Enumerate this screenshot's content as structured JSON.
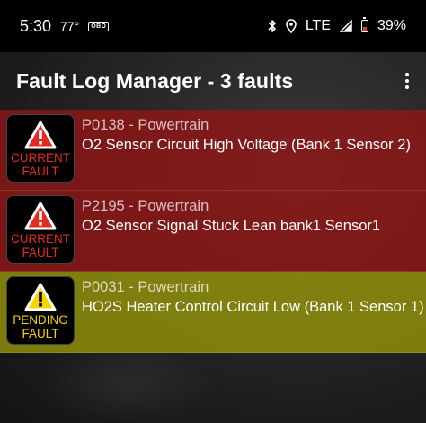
{
  "status_bar": {
    "time": "5:30",
    "temperature": "77°",
    "obd_icon_text": "OBD",
    "network": "LTE",
    "battery": "39%",
    "battery_color": "#e43b30"
  },
  "app_bar": {
    "title": "Fault Log Manager - 3 faults"
  },
  "faults": [
    {
      "badge_line1": "CURRENT",
      "badge_line2": "FAULT",
      "code_line": "P0138 - Powertrain",
      "description": "O2 Sensor Circuit High Voltage (Bank 1 Sensor 2)",
      "row_color": "#961414",
      "badge_color": "#e32b22"
    },
    {
      "badge_line1": "CURRENT",
      "badge_line2": "FAULT",
      "code_line": "P2195 - Powertrain",
      "description": "O2 Sensor Signal Stuck Lean bank1 Sensor1",
      "row_color": "#961414",
      "badge_color": "#e32b22"
    },
    {
      "badge_line1": "PENDING",
      "badge_line2": "FAULT",
      "code_line": "P0031 - Powertrain",
      "description": "HO2S Heater Control Circuit Low (Bank 1 Sensor 1)",
      "row_color": "#96960a",
      "badge_color": "#f5d400"
    }
  ]
}
